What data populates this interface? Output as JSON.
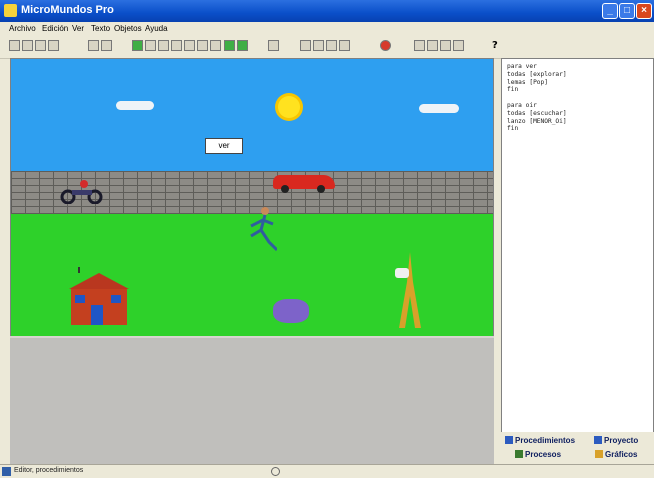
{
  "window": {
    "title": "MicroMundos Pro",
    "controls": {
      "minimize": "_",
      "maximize": "□",
      "close": "×"
    }
  },
  "menu": [
    "Archivo",
    "Edición",
    "Ver",
    "Texto",
    "Objetos",
    "Ayuda"
  ],
  "toolbar": {
    "buttons": [
      "new-icon",
      "open-icon",
      "save-icon",
      "print-icon",
      "cut-icon",
      "copy-icon",
      "turtle-icon",
      "paint-icon",
      "text-icon",
      "button-icon",
      "slider-icon",
      "music-icon",
      "shape-icon",
      "pointer-icon",
      "zoom-icon",
      "stamp-icon",
      "eraser-icon",
      "stop-icon",
      "pencil-icon",
      "paste-icon",
      "dropper-icon",
      "undo-icon",
      "help-icon"
    ]
  },
  "canvas": {
    "sign_label": "ver",
    "colors": {
      "sky": "#2e9ff0",
      "grass": "#2ed12a",
      "wall": "#8d8b86"
    }
  },
  "code_panel": {
    "lines": [
      "para ver",
      "todas [explorar]",
      "lemas [Pop]",
      "fin",
      "",
      "para oir",
      "todas [escuchar]",
      "lanzo [MENOR_Oi]",
      "fin"
    ]
  },
  "tabs": {
    "procedimientos": "Procedimientos",
    "proyecto": "Proyecto",
    "procesos": "Procesos",
    "graficos": "Gráficos"
  },
  "status": {
    "text": "Editor, procedimientos"
  }
}
